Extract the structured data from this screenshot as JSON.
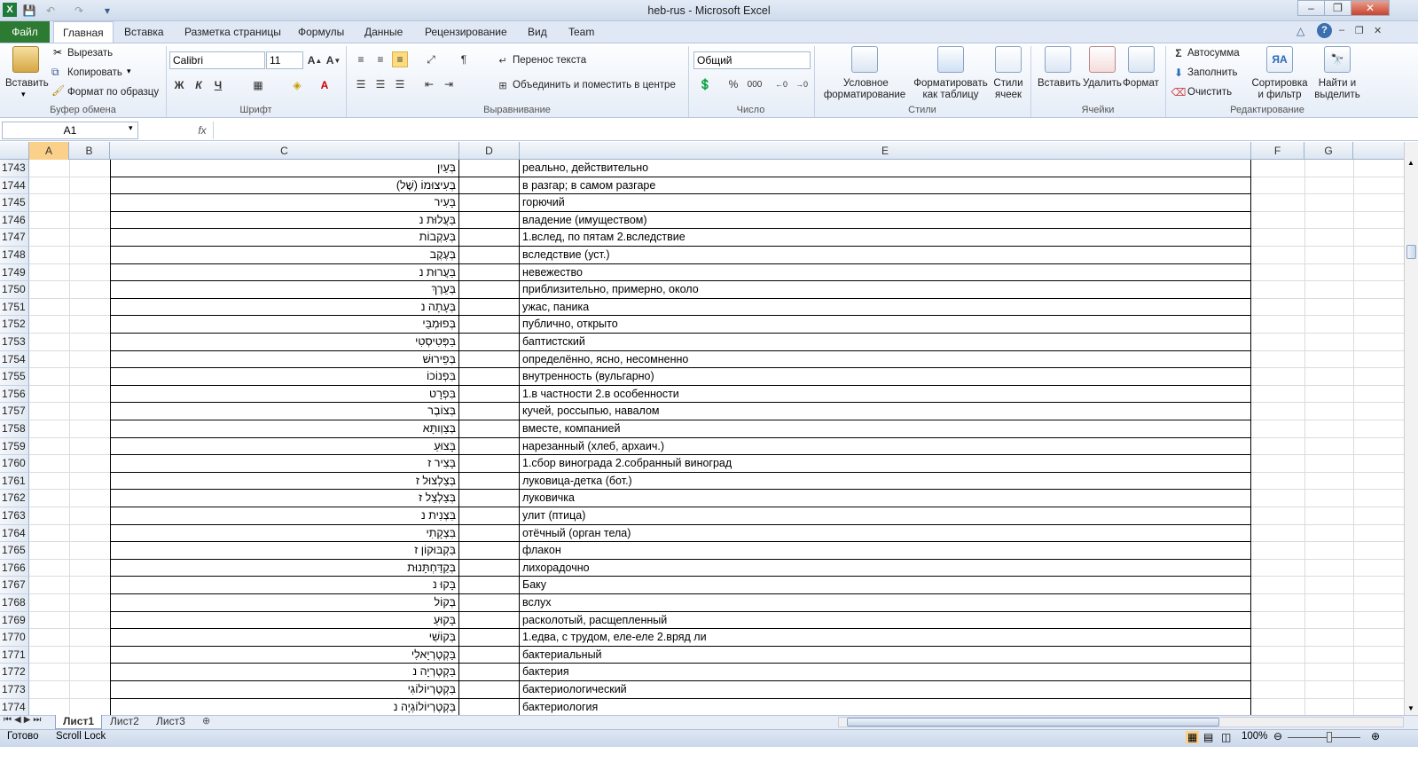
{
  "window": {
    "title": "heb-rus  -  Microsoft Excel"
  },
  "tabs": [
    "Файл",
    "Главная",
    "Вставка",
    "Разметка страницы",
    "Формулы",
    "Данные",
    "Рецензирование",
    "Вид",
    "Team"
  ],
  "ribbon": {
    "clipboard": {
      "paste": "Вставить",
      "cut": "Вырезать",
      "copy": "Копировать",
      "format_painter": "Формат по образцу",
      "label": "Буфер обмена"
    },
    "font": {
      "name": "Calibri",
      "size": "11",
      "label": "Шрифт"
    },
    "alignment": {
      "wrap": "Перенос текста",
      "merge": "Объединить и поместить в центре",
      "label": "Выравнивание"
    },
    "number": {
      "format": "Общий",
      "label": "Число",
      "percent": "%",
      "thousands": "000"
    },
    "styles": {
      "cond1": "Условное",
      "cond2": "форматирование",
      "table1": "Форматировать",
      "table2": "как таблицу",
      "cell1": "Стили",
      "cell2": "ячеек",
      "label": "Стили"
    },
    "cells": {
      "insert": "Вставить",
      "delete": "Удалить",
      "format": "Формат",
      "label": "Ячейки"
    },
    "editing": {
      "autosum": "Автосумма",
      "fill": "Заполнить",
      "clear": "Очистить",
      "sort1": "Сортировка",
      "sort2": "и фильтр",
      "find1": "Найти и",
      "find2": "выделить",
      "label": "Редактирование"
    }
  },
  "formula_bar": {
    "name_box": "A1",
    "fx": "fx",
    "value": ""
  },
  "columns": [
    "A",
    "B",
    "C",
    "D",
    "E",
    "F",
    "G"
  ],
  "rows": [
    {
      "n": "1743",
      "c": "בְּעַיִן",
      "e": "реально, действительно"
    },
    {
      "n": "1744",
      "c": "בְּעִיצוּמוֹ (שֶׁל)",
      "e": "в разгар; в самом разгаре"
    },
    {
      "n": "1745",
      "c": "בָּעִיר",
      "e": "горючий"
    },
    {
      "n": "1746",
      "c": "בַּעֲלוּת נ",
      "e": "владение (имуществом)"
    },
    {
      "n": "1747",
      "c": "בְּעִקְבוֹת",
      "e": "1.вслед, по пятам 2.вследствие"
    },
    {
      "n": "1748",
      "c": "בְּעֶקֶב",
      "e": "вследствие (уст.)"
    },
    {
      "n": "1749",
      "c": "בַּעֲרוּת נ",
      "e": "невежество"
    },
    {
      "n": "1750",
      "c": "בְּעֵרֶךְ",
      "e": "приблизительно, примерно, около"
    },
    {
      "n": "1751",
      "c": "בְּעָתָה נ",
      "e": "ужас, паника"
    },
    {
      "n": "1752",
      "c": "בְּפוּמְבֵּי",
      "e": "публично, открыто"
    },
    {
      "n": "1753",
      "c": "בַּפְּטִיסְטִי",
      "e": "баптистский"
    },
    {
      "n": "1754",
      "c": "בְּפֵירוּשׁ",
      "e": "определённо, ясно, несомненно"
    },
    {
      "n": "1755",
      "c": "בִּפְנוֹכוֹ",
      "e": "внутренность (вульгарно)"
    },
    {
      "n": "1756",
      "c": "בִּפְרָט",
      "e": "1.в частности 2.в особенности"
    },
    {
      "n": "1757",
      "c": "בְּצוֹבֶר",
      "e": "кучей, россыпью, навалом"
    },
    {
      "n": "1758",
      "c": "בְּצַוְותָּא",
      "e": "вместе, компанией"
    },
    {
      "n": "1759",
      "c": "בָּצוּעַ",
      "e": "нарезанный (хлеб, архаич.)"
    },
    {
      "n": "1760",
      "c": "בָּצִיר ז",
      "e": "1.сбор винограда 2.собранный виноград"
    },
    {
      "n": "1761",
      "c": "בְּצַלְצוּל ז",
      "e": "луковица-детка (бот.)"
    },
    {
      "n": "1762",
      "c": "בְּצַלְצַל ז",
      "e": "луковичка"
    },
    {
      "n": "1763",
      "c": "בִּצְנִית נ",
      "e": "улит (птица)"
    },
    {
      "n": "1764",
      "c": "בִּצְקָתִי",
      "e": "отёчный (орган тела)"
    },
    {
      "n": "1765",
      "c": "בַּקְבּוּקוֹן ז",
      "e": "флакон"
    },
    {
      "n": "1766",
      "c": "בְּקַדַּחְתָּנוּת",
      "e": "лихорадочно"
    },
    {
      "n": "1767",
      "c": "בָּקוּ נ",
      "e": "Баку"
    },
    {
      "n": "1768",
      "c": "בְּקוֹל",
      "e": "вслух"
    },
    {
      "n": "1769",
      "c": "בָּקוּעַ",
      "e": "расколотый, расщепленный"
    },
    {
      "n": "1770",
      "c": "בְּקוֹשִׁי",
      "e": "1.едва, с трудом, еле-еле 2.вряд ли"
    },
    {
      "n": "1771",
      "c": "בַּקְטֶרְיָאלִי",
      "e": "бактериальный"
    },
    {
      "n": "1772",
      "c": "בַּקְטֶרְיָה נ",
      "e": "бактерия"
    },
    {
      "n": "1773",
      "c": "בַּקְטֶרְיוֹלוֹגִי",
      "e": "бактериологический"
    },
    {
      "n": "1774",
      "c": "בַּקְטֶרְיוֹלוֹגְיָה נ",
      "e": "бактериология"
    }
  ],
  "sheets": [
    "Лист1",
    "Лист2",
    "Лист3"
  ],
  "status": {
    "ready": "Готово",
    "scroll_lock": "Scroll Lock",
    "zoom": "100%"
  },
  "colors": {
    "file_tab": "#2d7a33",
    "header_bg": "#dde6f1",
    "grid_line": "#dadcdd"
  }
}
